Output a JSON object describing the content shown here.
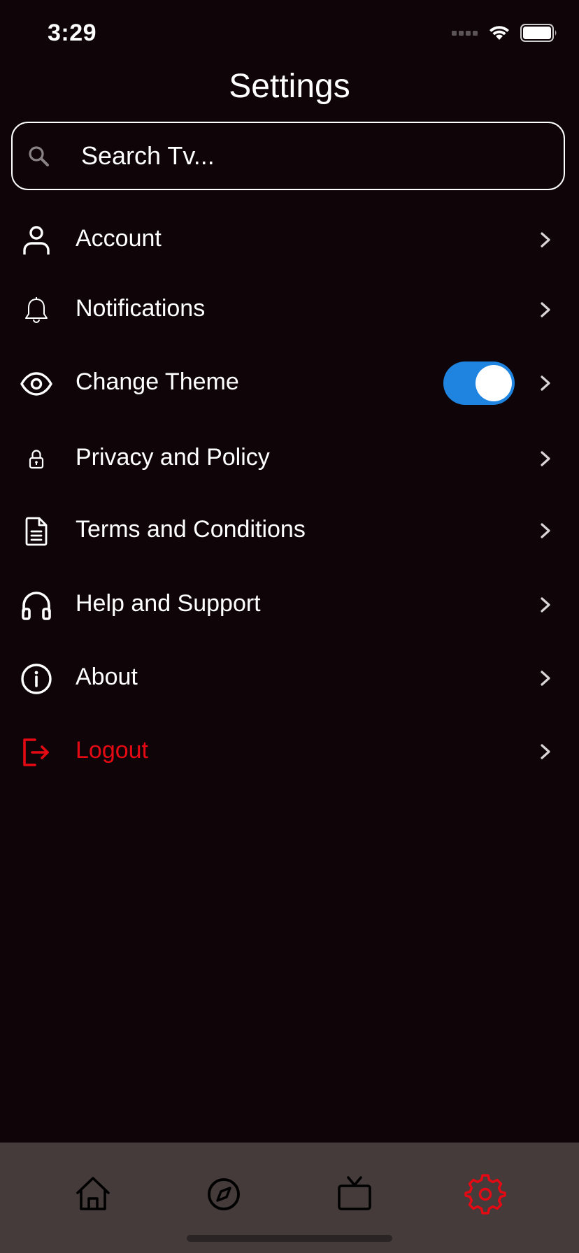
{
  "status_bar": {
    "time": "3:29"
  },
  "header": {
    "title": "Settings"
  },
  "search": {
    "placeholder": "Search Tv..."
  },
  "settings": {
    "items": [
      {
        "label": "Account",
        "icon": "user-icon"
      },
      {
        "label": "Notifications",
        "icon": "bell-icon"
      },
      {
        "label": "Change Theme",
        "icon": "eye-icon",
        "toggle_on": true
      },
      {
        "label": "Privacy and Policy",
        "icon": "lock-icon"
      },
      {
        "label": "Terms and Conditions",
        "icon": "document-icon"
      },
      {
        "label": "Help and Support",
        "icon": "headphones-icon"
      },
      {
        "label": "About",
        "icon": "info-icon"
      },
      {
        "label": "Logout",
        "icon": "logout-icon"
      }
    ]
  },
  "tab_bar": {
    "tabs": [
      {
        "icon": "home-icon",
        "active": false
      },
      {
        "icon": "compass-icon",
        "active": false
      },
      {
        "icon": "tv-icon",
        "active": false
      },
      {
        "icon": "gear-icon",
        "active": true
      }
    ]
  },
  "colors": {
    "background": "#0f0508",
    "accent_red": "#e50914",
    "toggle_blue": "#1f84e0",
    "tab_bar_bg": "#453b3b"
  }
}
